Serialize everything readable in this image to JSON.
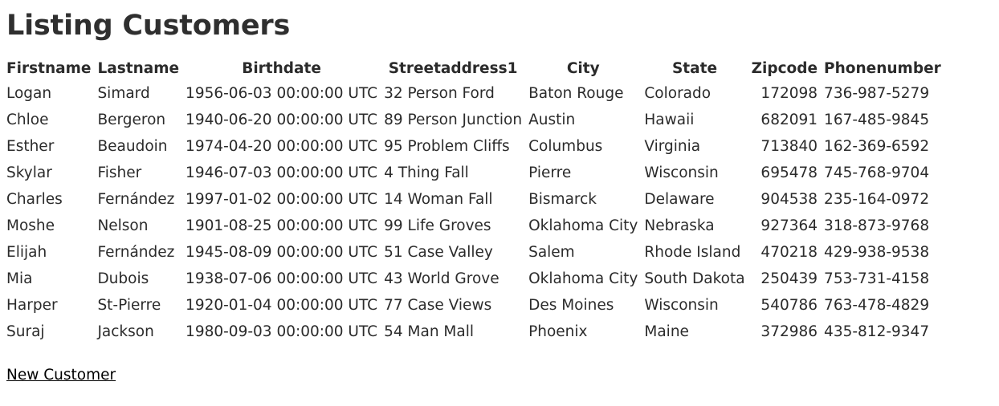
{
  "page": {
    "title": "Listing Customers"
  },
  "table": {
    "columns": [
      {
        "key": "firstname",
        "label": "Firstname"
      },
      {
        "key": "lastname",
        "label": "Lastname"
      },
      {
        "key": "birthdate",
        "label": "Birthdate"
      },
      {
        "key": "street",
        "label": "Streetaddress1"
      },
      {
        "key": "city",
        "label": "City"
      },
      {
        "key": "state",
        "label": "State"
      },
      {
        "key": "zipcode",
        "label": "Zipcode"
      },
      {
        "key": "phone",
        "label": "Phonenumber"
      }
    ],
    "rows": [
      {
        "firstname": "Logan",
        "lastname": "Simard",
        "birthdate": "1956-06-03 00:00:00 UTC",
        "street": "32 Person Ford",
        "city": "Baton Rouge",
        "state": "Colorado",
        "zipcode": "172098",
        "phone": "736-987-5279"
      },
      {
        "firstname": "Chloe",
        "lastname": "Bergeron",
        "birthdate": "1940-06-20 00:00:00 UTC",
        "street": "89 Person Junction",
        "city": "Austin",
        "state": "Hawaii",
        "zipcode": "682091",
        "phone": "167-485-9845"
      },
      {
        "firstname": "Esther",
        "lastname": "Beaudoin",
        "birthdate": "1974-04-20 00:00:00 UTC",
        "street": "95 Problem Cliffs",
        "city": "Columbus",
        "state": "Virginia",
        "zipcode": "713840",
        "phone": "162-369-6592"
      },
      {
        "firstname": "Skylar",
        "lastname": "Fisher",
        "birthdate": "1946-07-03 00:00:00 UTC",
        "street": "4 Thing Fall",
        "city": "Pierre",
        "state": "Wisconsin",
        "zipcode": "695478",
        "phone": "745-768-9704"
      },
      {
        "firstname": "Charles",
        "lastname": "Fernández",
        "birthdate": "1997-01-02 00:00:00 UTC",
        "street": "14 Woman Fall",
        "city": "Bismarck",
        "state": "Delaware",
        "zipcode": "904538",
        "phone": "235-164-0972"
      },
      {
        "firstname": "Moshe",
        "lastname": "Nelson",
        "birthdate": "1901-08-25 00:00:00 UTC",
        "street": "99 Life Groves",
        "city": "Oklahoma City",
        "state": "Nebraska",
        "zipcode": "927364",
        "phone": "318-873-9768"
      },
      {
        "firstname": "Elijah",
        "lastname": "Fernández",
        "birthdate": "1945-08-09 00:00:00 UTC",
        "street": "51 Case Valley",
        "city": "Salem",
        "state": "Rhode Island",
        "zipcode": "470218",
        "phone": "429-938-9538"
      },
      {
        "firstname": "Mia",
        "lastname": "Dubois",
        "birthdate": "1938-07-06 00:00:00 UTC",
        "street": "43 World Grove",
        "city": "Oklahoma City",
        "state": "South Dakota",
        "zipcode": "250439",
        "phone": "753-731-4158"
      },
      {
        "firstname": "Harper",
        "lastname": "St-Pierre",
        "birthdate": "1920-01-04 00:00:00 UTC",
        "street": "77 Case Views",
        "city": "Des Moines",
        "state": "Wisconsin",
        "zipcode": "540786",
        "phone": "763-478-4829"
      },
      {
        "firstname": "Suraj",
        "lastname": "Jackson",
        "birthdate": "1980-09-03 00:00:00 UTC",
        "street": "54 Man Mall",
        "city": "Phoenix",
        "state": "Maine",
        "zipcode": "372986",
        "phone": "435-812-9347"
      }
    ]
  },
  "actions": {
    "new_customer_label": "New Customer"
  },
  "colors": {
    "text": "#2b2b2b",
    "title": "#2f2f2f",
    "link": "#000000",
    "background": "#ffffff"
  }
}
